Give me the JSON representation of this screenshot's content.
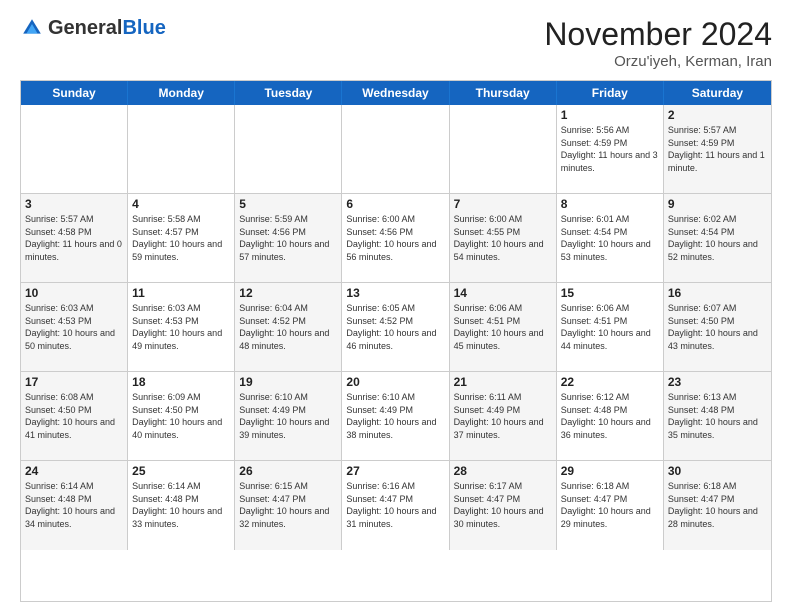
{
  "header": {
    "logo_general": "General",
    "logo_blue": "Blue",
    "month_title": "November 2024",
    "location": "Orzu'iyeh, Kerman, Iran"
  },
  "day_names": [
    "Sunday",
    "Monday",
    "Tuesday",
    "Wednesday",
    "Thursday",
    "Friday",
    "Saturday"
  ],
  "weeks": [
    [
      {
        "date": "",
        "sunrise": "",
        "sunset": "",
        "daylight": ""
      },
      {
        "date": "",
        "sunrise": "",
        "sunset": "",
        "daylight": ""
      },
      {
        "date": "",
        "sunrise": "",
        "sunset": "",
        "daylight": ""
      },
      {
        "date": "",
        "sunrise": "",
        "sunset": "",
        "daylight": ""
      },
      {
        "date": "",
        "sunrise": "",
        "sunset": "",
        "daylight": ""
      },
      {
        "date": "1",
        "sunrise": "Sunrise: 5:56 AM",
        "sunset": "Sunset: 4:59 PM",
        "daylight": "Daylight: 11 hours and 3 minutes."
      },
      {
        "date": "2",
        "sunrise": "Sunrise: 5:57 AM",
        "sunset": "Sunset: 4:59 PM",
        "daylight": "Daylight: 11 hours and 1 minute."
      }
    ],
    [
      {
        "date": "3",
        "sunrise": "Sunrise: 5:57 AM",
        "sunset": "Sunset: 4:58 PM",
        "daylight": "Daylight: 11 hours and 0 minutes."
      },
      {
        "date": "4",
        "sunrise": "Sunrise: 5:58 AM",
        "sunset": "Sunset: 4:57 PM",
        "daylight": "Daylight: 10 hours and 59 minutes."
      },
      {
        "date": "5",
        "sunrise": "Sunrise: 5:59 AM",
        "sunset": "Sunset: 4:56 PM",
        "daylight": "Daylight: 10 hours and 57 minutes."
      },
      {
        "date": "6",
        "sunrise": "Sunrise: 6:00 AM",
        "sunset": "Sunset: 4:56 PM",
        "daylight": "Daylight: 10 hours and 56 minutes."
      },
      {
        "date": "7",
        "sunrise": "Sunrise: 6:00 AM",
        "sunset": "Sunset: 4:55 PM",
        "daylight": "Daylight: 10 hours and 54 minutes."
      },
      {
        "date": "8",
        "sunrise": "Sunrise: 6:01 AM",
        "sunset": "Sunset: 4:54 PM",
        "daylight": "Daylight: 10 hours and 53 minutes."
      },
      {
        "date": "9",
        "sunrise": "Sunrise: 6:02 AM",
        "sunset": "Sunset: 4:54 PM",
        "daylight": "Daylight: 10 hours and 52 minutes."
      }
    ],
    [
      {
        "date": "10",
        "sunrise": "Sunrise: 6:03 AM",
        "sunset": "Sunset: 4:53 PM",
        "daylight": "Daylight: 10 hours and 50 minutes."
      },
      {
        "date": "11",
        "sunrise": "Sunrise: 6:03 AM",
        "sunset": "Sunset: 4:53 PM",
        "daylight": "Daylight: 10 hours and 49 minutes."
      },
      {
        "date": "12",
        "sunrise": "Sunrise: 6:04 AM",
        "sunset": "Sunset: 4:52 PM",
        "daylight": "Daylight: 10 hours and 48 minutes."
      },
      {
        "date": "13",
        "sunrise": "Sunrise: 6:05 AM",
        "sunset": "Sunset: 4:52 PM",
        "daylight": "Daylight: 10 hours and 46 minutes."
      },
      {
        "date": "14",
        "sunrise": "Sunrise: 6:06 AM",
        "sunset": "Sunset: 4:51 PM",
        "daylight": "Daylight: 10 hours and 45 minutes."
      },
      {
        "date": "15",
        "sunrise": "Sunrise: 6:06 AM",
        "sunset": "Sunset: 4:51 PM",
        "daylight": "Daylight: 10 hours and 44 minutes."
      },
      {
        "date": "16",
        "sunrise": "Sunrise: 6:07 AM",
        "sunset": "Sunset: 4:50 PM",
        "daylight": "Daylight: 10 hours and 43 minutes."
      }
    ],
    [
      {
        "date": "17",
        "sunrise": "Sunrise: 6:08 AM",
        "sunset": "Sunset: 4:50 PM",
        "daylight": "Daylight: 10 hours and 41 minutes."
      },
      {
        "date": "18",
        "sunrise": "Sunrise: 6:09 AM",
        "sunset": "Sunset: 4:50 PM",
        "daylight": "Daylight: 10 hours and 40 minutes."
      },
      {
        "date": "19",
        "sunrise": "Sunrise: 6:10 AM",
        "sunset": "Sunset: 4:49 PM",
        "daylight": "Daylight: 10 hours and 39 minutes."
      },
      {
        "date": "20",
        "sunrise": "Sunrise: 6:10 AM",
        "sunset": "Sunset: 4:49 PM",
        "daylight": "Daylight: 10 hours and 38 minutes."
      },
      {
        "date": "21",
        "sunrise": "Sunrise: 6:11 AM",
        "sunset": "Sunset: 4:49 PM",
        "daylight": "Daylight: 10 hours and 37 minutes."
      },
      {
        "date": "22",
        "sunrise": "Sunrise: 6:12 AM",
        "sunset": "Sunset: 4:48 PM",
        "daylight": "Daylight: 10 hours and 36 minutes."
      },
      {
        "date": "23",
        "sunrise": "Sunrise: 6:13 AM",
        "sunset": "Sunset: 4:48 PM",
        "daylight": "Daylight: 10 hours and 35 minutes."
      }
    ],
    [
      {
        "date": "24",
        "sunrise": "Sunrise: 6:14 AM",
        "sunset": "Sunset: 4:48 PM",
        "daylight": "Daylight: 10 hours and 34 minutes."
      },
      {
        "date": "25",
        "sunrise": "Sunrise: 6:14 AM",
        "sunset": "Sunset: 4:48 PM",
        "daylight": "Daylight: 10 hours and 33 minutes."
      },
      {
        "date": "26",
        "sunrise": "Sunrise: 6:15 AM",
        "sunset": "Sunset: 4:47 PM",
        "daylight": "Daylight: 10 hours and 32 minutes."
      },
      {
        "date": "27",
        "sunrise": "Sunrise: 6:16 AM",
        "sunset": "Sunset: 4:47 PM",
        "daylight": "Daylight: 10 hours and 31 minutes."
      },
      {
        "date": "28",
        "sunrise": "Sunrise: 6:17 AM",
        "sunset": "Sunset: 4:47 PM",
        "daylight": "Daylight: 10 hours and 30 minutes."
      },
      {
        "date": "29",
        "sunrise": "Sunrise: 6:18 AM",
        "sunset": "Sunset: 4:47 PM",
        "daylight": "Daylight: 10 hours and 29 minutes."
      },
      {
        "date": "30",
        "sunrise": "Sunrise: 6:18 AM",
        "sunset": "Sunset: 4:47 PM",
        "daylight": "Daylight: 10 hours and 28 minutes."
      }
    ]
  ]
}
